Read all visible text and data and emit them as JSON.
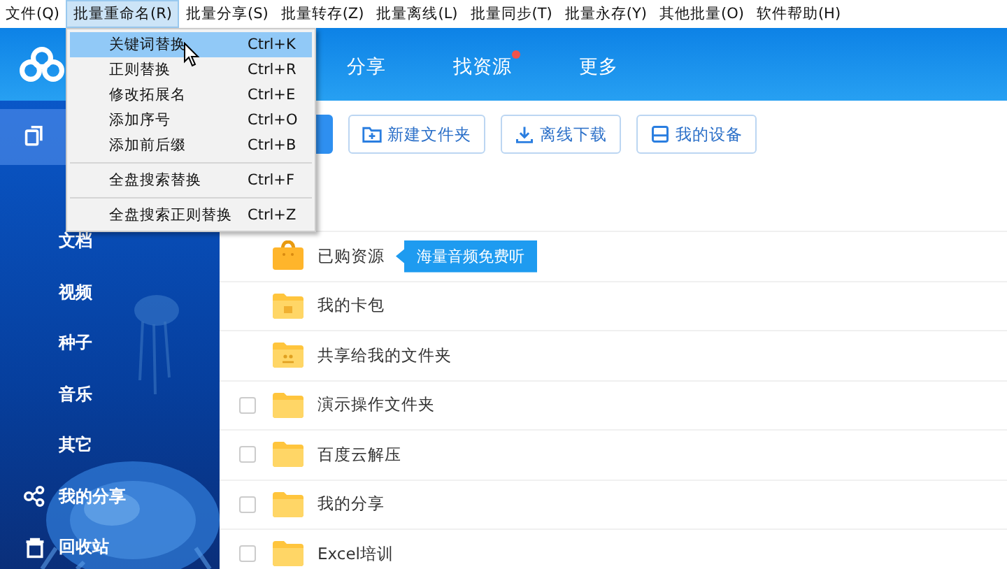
{
  "menubar": [
    {
      "label": "文件(Q)",
      "selected": false
    },
    {
      "label": "批量重命名(R)",
      "selected": true
    },
    {
      "label": "批量分享(S)",
      "selected": false
    },
    {
      "label": "批量转存(Z)",
      "selected": false
    },
    {
      "label": "批量离线(L)",
      "selected": false
    },
    {
      "label": "批量同步(T)",
      "selected": false
    },
    {
      "label": "批量永存(Y)",
      "selected": false
    },
    {
      "label": "其他批量(O)",
      "selected": false
    },
    {
      "label": "软件帮助(H)",
      "selected": false
    }
  ],
  "menu": [
    {
      "label": "关键词替换",
      "shortcut": "Ctrl+K",
      "selected": true,
      "separator_after": false
    },
    {
      "label": "正则替换",
      "shortcut": "Ctrl+R",
      "selected": false,
      "separator_after": false
    },
    {
      "label": "修改拓展名",
      "shortcut": "Ctrl+E",
      "selected": false,
      "separator_after": false
    },
    {
      "label": "添加序号",
      "shortcut": "Ctrl+O",
      "selected": false,
      "separator_after": false
    },
    {
      "label": "添加前后缀",
      "shortcut": "Ctrl+B",
      "selected": false,
      "separator_after": true
    },
    {
      "label": "全盘搜索替换",
      "shortcut": "Ctrl+F",
      "selected": false,
      "separator_after": true
    },
    {
      "label": "全盘搜索正则替换",
      "shortcut": "Ctrl+Z",
      "selected": false,
      "separator_after": false
    }
  ],
  "nav": [
    {
      "label": "分享",
      "dot": false
    },
    {
      "label": "找资源",
      "dot": true
    },
    {
      "label": "更多",
      "dot": false
    }
  ],
  "sidebar": {
    "items": [
      {
        "kind": "files",
        "selected": true
      },
      {
        "kind": "hidden"
      },
      {
        "kind": "category",
        "label": "文档",
        "selected": false
      },
      {
        "kind": "category",
        "label": "视频",
        "selected": false
      },
      {
        "kind": "category",
        "label": "种子",
        "selected": false
      },
      {
        "kind": "category",
        "label": "音乐",
        "selected": false
      },
      {
        "kind": "category",
        "label": "其它",
        "selected": false
      },
      {
        "kind": "share",
        "label": "我的分享",
        "selected": false
      },
      {
        "kind": "trash",
        "label": "回收站",
        "selected": false
      }
    ]
  },
  "toolbar": [
    {
      "kind": "primary"
    },
    {
      "kind": "folder",
      "label": "新建文件夹"
    },
    {
      "kind": "download",
      "label": "离线下载"
    },
    {
      "kind": "device",
      "label": "我的设备"
    }
  ],
  "files": [
    {
      "kind": "purchased",
      "name": "已购资源",
      "tooltip": "海量音频免费听"
    },
    {
      "kind": "cardpack",
      "name": "我的卡包"
    },
    {
      "kind": "shared",
      "name": "共享给我的文件夹"
    },
    {
      "kind": "folder",
      "name": "演示操作文件夹",
      "checked": false
    },
    {
      "kind": "folder",
      "name": "百度云解压",
      "checked": false
    },
    {
      "kind": "folder",
      "name": "我的分享",
      "checked": false
    },
    {
      "kind": "folder",
      "name": "Excel培训",
      "checked": false
    }
  ]
}
